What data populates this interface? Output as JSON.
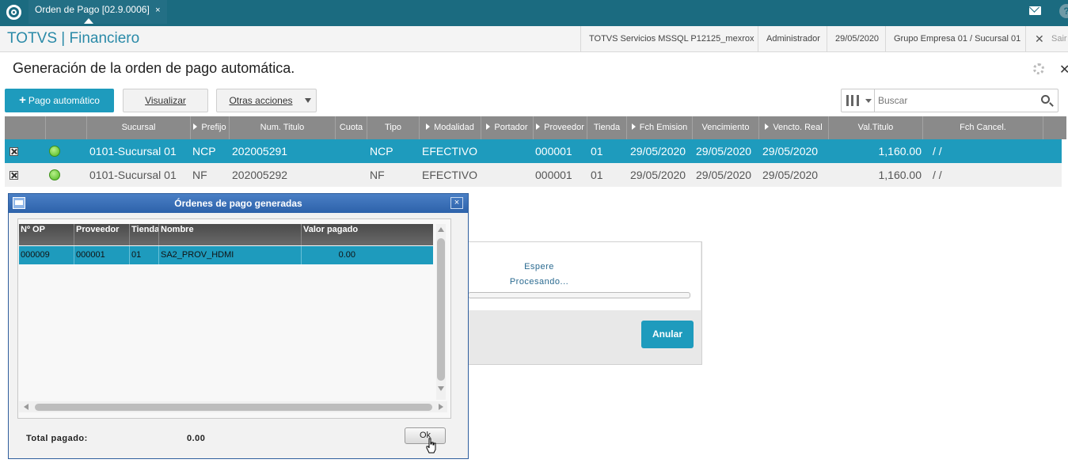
{
  "topbar": {
    "tab_label": "Orden de Pago [02.9.0006]",
    "tab_close": "×",
    "help": "?"
  },
  "header": {
    "brand": "TOTVS | Financiero",
    "server": "TOTVS Servicios MSSQL P12125_mexrox",
    "user": "Administrador",
    "date": "29/05/2020",
    "company": "Grupo Empresa 01 / Sucursal 01",
    "exit_label": "Sair"
  },
  "page": {
    "title": "Generación de la orden de pago automática."
  },
  "toolbar": {
    "primary_label": "Pago automático",
    "visualizar_label": "Visualizar",
    "otras_label": "Otras acciones",
    "search_placeholder": "Buscar"
  },
  "grid": {
    "columns": [
      "Sucursal",
      "Prefijo",
      "Num. Titulo",
      "Cuota",
      "Tipo",
      "Modalidad",
      "Portador",
      "Proveedor",
      "Tienda",
      "Fch Emision",
      "Vencimiento",
      "Vencto. Real",
      "Val.Titulo",
      "Fch Cancel."
    ],
    "rows": [
      {
        "sucursal": "0101-Sucursal 01",
        "prefijo": "NCP",
        "num": "202005291",
        "cuota": "",
        "tipo": "NCP",
        "modalidad": "EFECTIVO",
        "portador": "",
        "proveedor": "000001",
        "tienda": "01",
        "emision": "29/05/2020",
        "vencimiento": "29/05/2020",
        "vencto_real": "29/05/2020",
        "valor": "1,160.00",
        "cancel": "/  /"
      },
      {
        "sucursal": "0101-Sucursal 01",
        "prefijo": "NF",
        "num": "202005292",
        "cuota": "",
        "tipo": "NF",
        "modalidad": "EFECTIVO",
        "portador": "",
        "proveedor": "000001",
        "tienda": "01",
        "emision": "29/05/2020",
        "vencimiento": "29/05/2020",
        "vencto_real": "29/05/2020",
        "valor": "1,160.00",
        "cancel": "/  /"
      }
    ]
  },
  "progress_dialog": {
    "title": "Espere",
    "subtitle": "Procesando...",
    "cancel_label": "Anular"
  },
  "modal": {
    "title": "Órdenes de pago generadas",
    "close": "×",
    "columns": [
      "Nº OP",
      "Proveedor",
      "Tienda",
      "Nombre",
      "Valor pagado"
    ],
    "rows": [
      {
        "op": "000009",
        "proveedor": "000001",
        "tienda": "01",
        "nombre": "SA2_PROV_HDMI",
        "valor": "0.00"
      }
    ],
    "total_label": "Total pagado:",
    "total_value": "0.00",
    "ok_label": "Ok"
  },
  "colors": {
    "topbar": "#1b6b80",
    "accent": "#1e9bbd",
    "modal_title": "#2d62aa"
  }
}
